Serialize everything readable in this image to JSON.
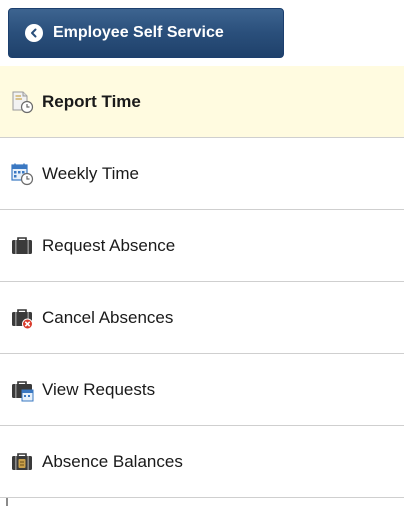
{
  "header": {
    "back_label": "Employee Self Service"
  },
  "menu": {
    "items": [
      {
        "label": "Report Time",
        "icon": "report-time-icon",
        "selected": true
      },
      {
        "label": "Weekly Time",
        "icon": "weekly-time-icon",
        "selected": false
      },
      {
        "label": "Request Absence",
        "icon": "briefcase-icon",
        "selected": false
      },
      {
        "label": "Cancel Absences",
        "icon": "briefcase-cancel-icon",
        "selected": false
      },
      {
        "label": "View Requests",
        "icon": "briefcase-calendar-icon",
        "selected": false
      },
      {
        "label": "Absence Balances",
        "icon": "briefcase-balance-icon",
        "selected": false
      }
    ]
  },
  "colors": {
    "header_button": "#2a4f7b",
    "selected_row": "#fffbe0",
    "divider": "#cfcfcf"
  }
}
